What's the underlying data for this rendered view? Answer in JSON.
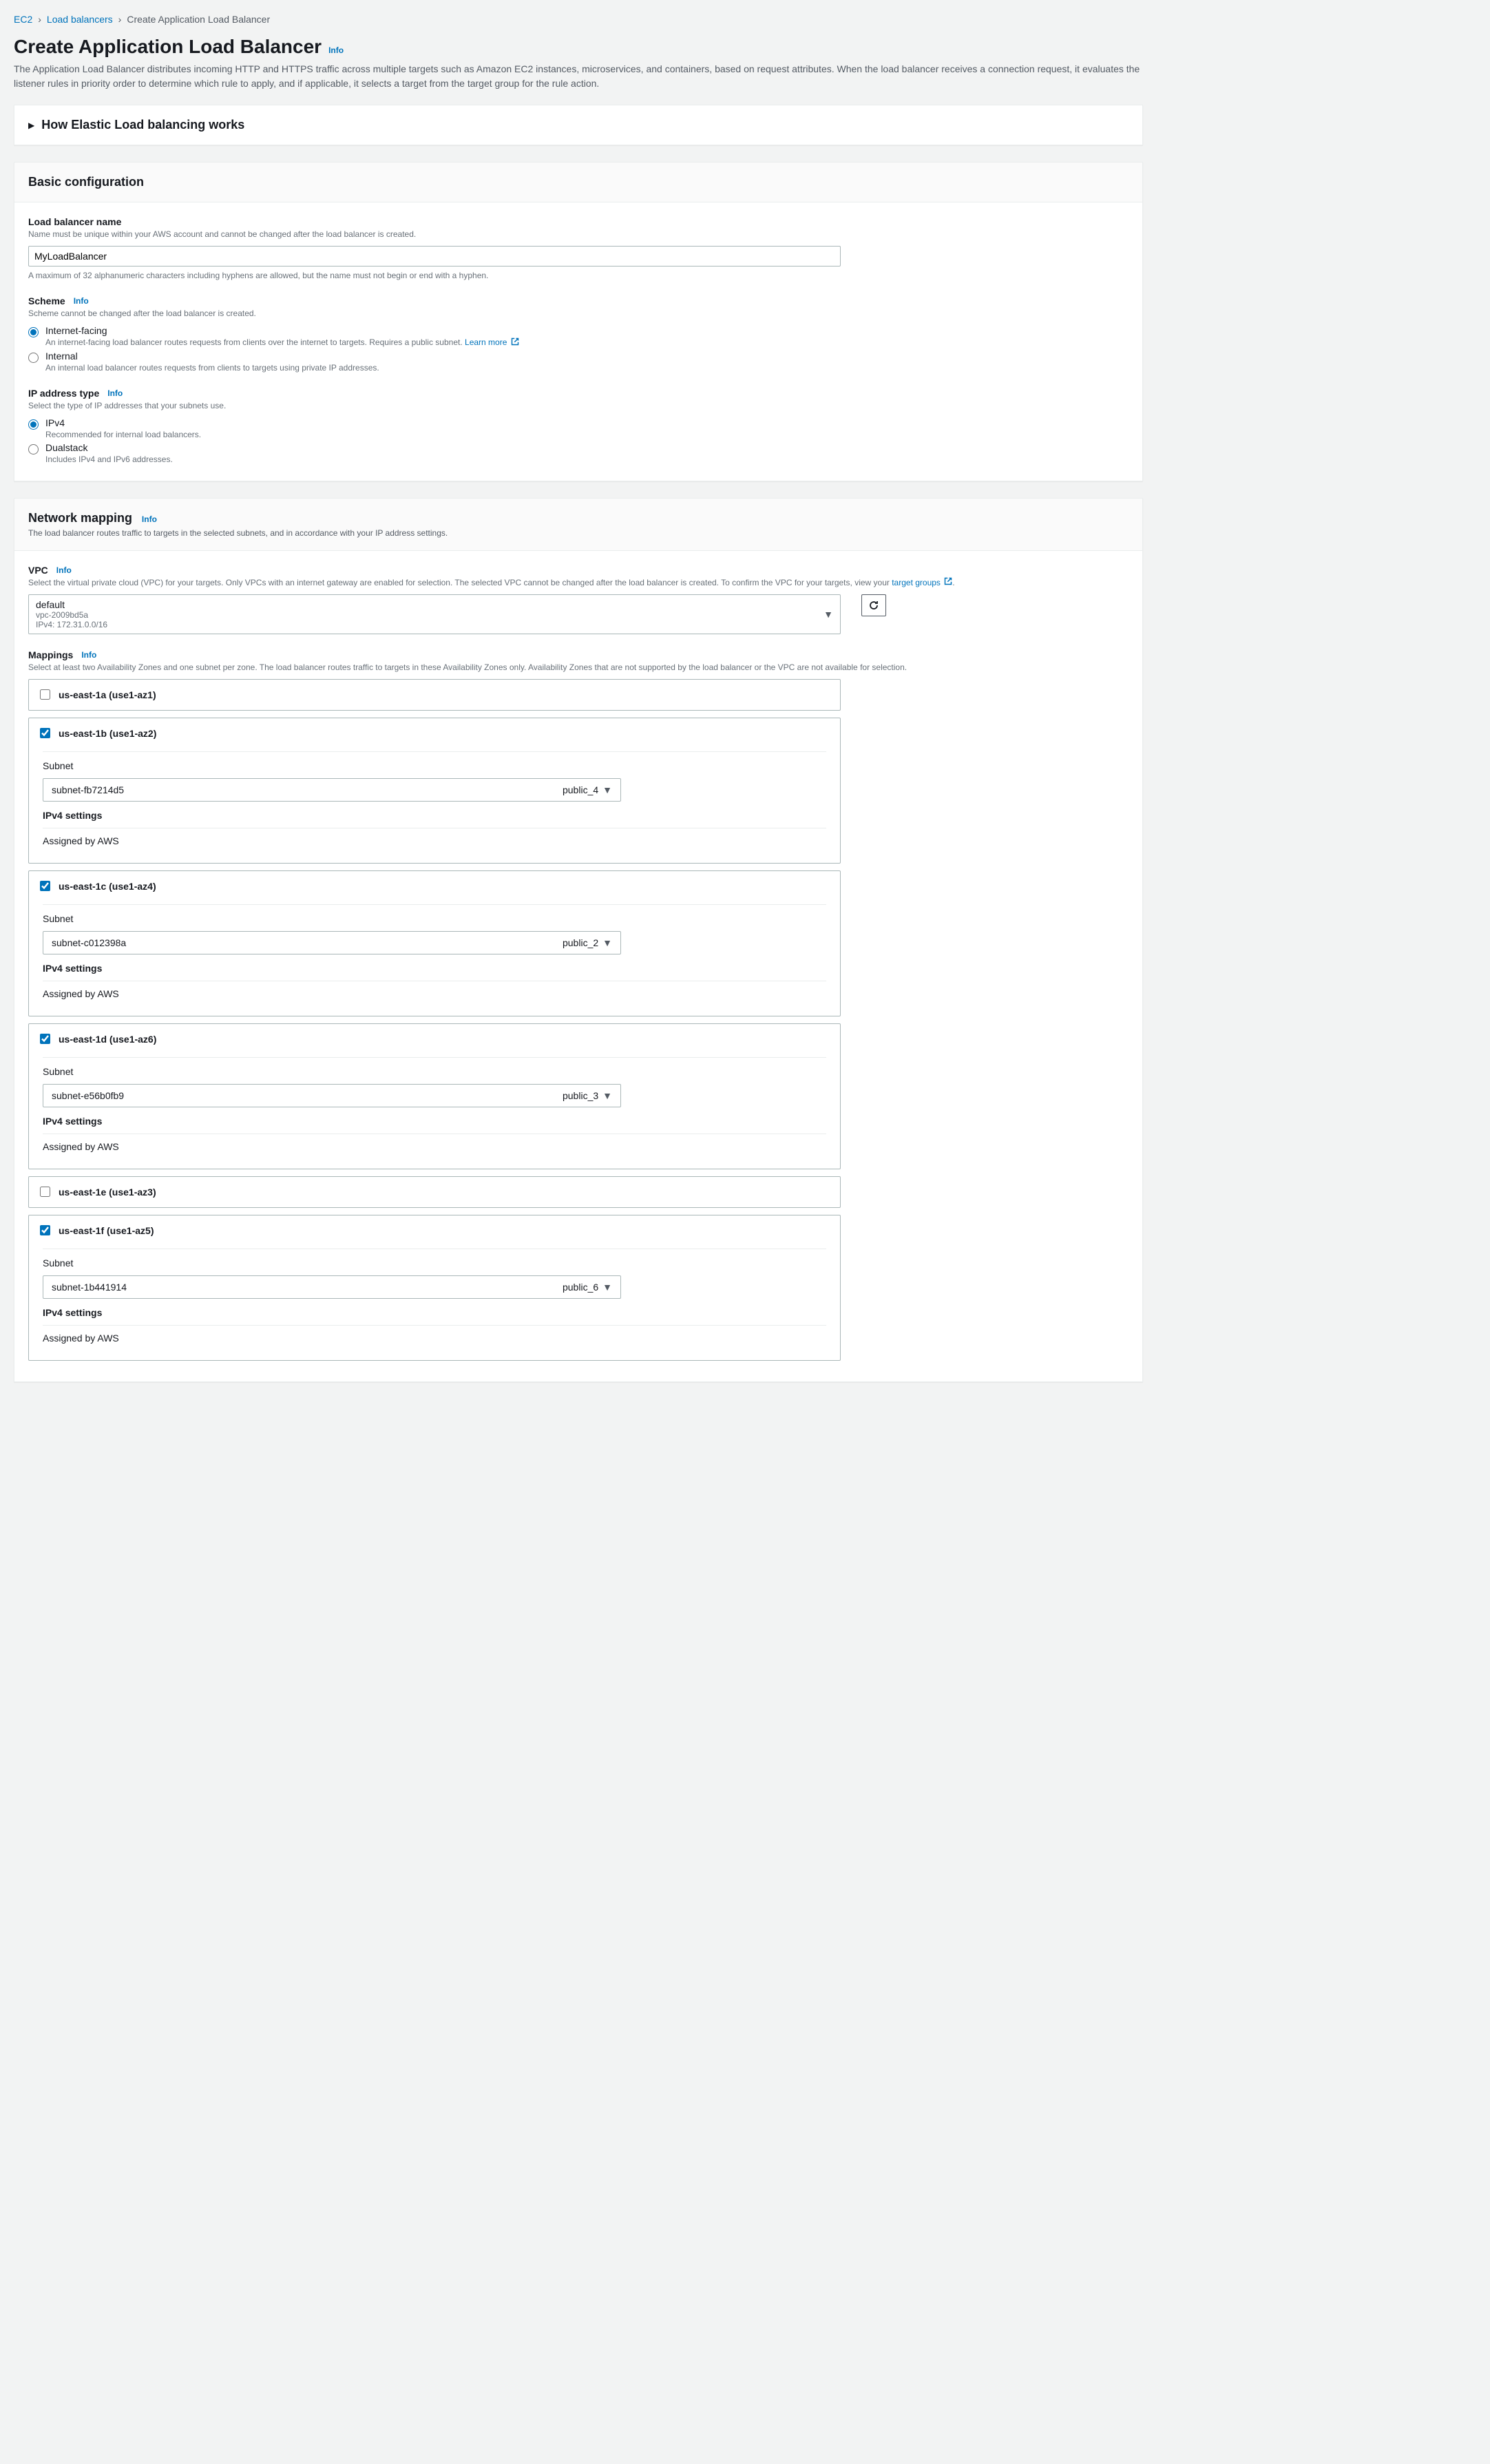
{
  "breadcrumb": {
    "ec2": "EC2",
    "lb": "Load balancers",
    "current": "Create Application Load Balancer"
  },
  "page": {
    "title": "Create Application Load Balancer",
    "info": "Info",
    "desc": "The Application Load Balancer distributes incoming HTTP and HTTPS traffic across multiple targets such as Amazon EC2 instances, microservices, and containers, based on request attributes. When the load balancer receives a connection request, it evaluates the listener rules in priority order to determine which rule to apply, and if applicable, it selects a target from the target group for the rule action."
  },
  "how_works": "How Elastic Load balancing works",
  "basic": {
    "title": "Basic configuration",
    "name_label": "Load balancer name",
    "name_desc": "Name must be unique within your AWS account and cannot be changed after the load balancer is created.",
    "name_value": "MyLoadBalancer",
    "name_constraint": "A maximum of 32 alphanumeric characters including hyphens are allowed, but the name must not begin or end with a hyphen.",
    "scheme_label": "Scheme",
    "scheme_info": "Info",
    "scheme_desc": "Scheme cannot be changed after the load balancer is created.",
    "scheme_opt1": "Internet-facing",
    "scheme_opt1_desc": "An internet-facing load balancer routes requests from clients over the internet to targets. Requires a public subnet.",
    "scheme_learn": "Learn more",
    "scheme_opt2": "Internal",
    "scheme_opt2_desc": "An internal load balancer routes requests from clients to targets using private IP addresses.",
    "ip_label": "IP address type",
    "ip_info": "Info",
    "ip_desc": "Select the type of IP addresses that your subnets use.",
    "ip_opt1": "IPv4",
    "ip_opt1_desc": "Recommended for internal load balancers.",
    "ip_opt2": "Dualstack",
    "ip_opt2_desc": "Includes IPv4 and IPv6 addresses."
  },
  "network": {
    "title": "Network mapping",
    "info": "Info",
    "desc": "The load balancer routes traffic to targets in the selected subnets, and in accordance with your IP address settings.",
    "vpc_label": "VPC",
    "vpc_info": "Info",
    "vpc_desc_a": "Select the virtual private cloud (VPC) for your targets. Only VPCs with an internet gateway are enabled for selection. The selected VPC cannot be changed after the load balancer is created. To confirm the VPC for your targets, view your ",
    "vpc_desc_link": "target groups",
    "vpc_desc_b": ".",
    "vpc_name": "default",
    "vpc_id": "vpc-2009bd5a",
    "vpc_cidr": "IPv4: 172.31.0.0/16",
    "map_label": "Mappings",
    "map_info": "Info",
    "map_desc": "Select at least two Availability Zones and one subnet per zone. The load balancer routes traffic to targets in these Availability Zones only. Availability Zones that are not supported by the load balancer or the VPC are not available for selection.",
    "subnet_label": "Subnet",
    "ipv4_label": "IPv4 settings",
    "assigned": "Assigned by AWS",
    "az": [
      {
        "name": "us-east-1a (use1-az1)",
        "checked": false
      },
      {
        "name": "us-east-1b (use1-az2)",
        "checked": true,
        "subnet_id": "subnet-fb7214d5",
        "subnet_tag": "public_4"
      },
      {
        "name": "us-east-1c (use1-az4)",
        "checked": true,
        "subnet_id": "subnet-c012398a",
        "subnet_tag": "public_2"
      },
      {
        "name": "us-east-1d (use1-az6)",
        "checked": true,
        "subnet_id": "subnet-e56b0fb9",
        "subnet_tag": "public_3"
      },
      {
        "name": "us-east-1e (use1-az3)",
        "checked": false
      },
      {
        "name": "us-east-1f (use1-az5)",
        "checked": true,
        "subnet_id": "subnet-1b441914",
        "subnet_tag": "public_6"
      }
    ]
  }
}
